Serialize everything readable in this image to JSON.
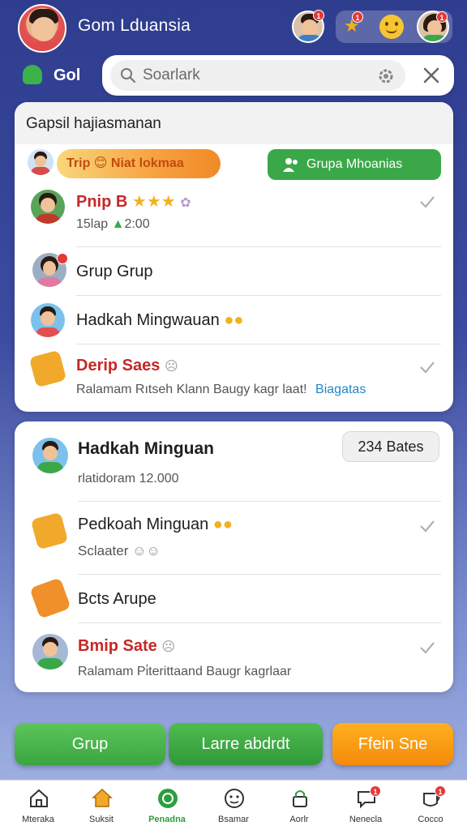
{
  "header": {
    "title": "Gom Lduansia",
    "top_badges": [
      "1",
      "1",
      "1"
    ]
  },
  "search": {
    "group_label": "Gol",
    "placeholder": "Soarlark"
  },
  "card1": {
    "title": "Gapsil hajiasmanan",
    "pill_label": "Trip 😊 Niat lokmaa",
    "button_label": "Grupa Mhoanias",
    "rows": [
      {
        "name": "Pnip B",
        "sub_left": "15lap",
        "sub_right": "2:00"
      },
      {
        "name": "Grup Grup"
      },
      {
        "name": "Hadkah Mingwauan"
      },
      {
        "name": "Derip Saes",
        "sub": "Ralamam Rıtseh Klann Baugy kagr laat!",
        "link": "Biagatas"
      }
    ]
  },
  "card2": {
    "rows": [
      {
        "name": "Hadkah Minguan",
        "sub": "rlatidoram 12.000",
        "badge": "234 Bates"
      },
      {
        "name": "Pedkoah Minguan",
        "sub": "Sclaater"
      },
      {
        "name": "Bcts Arupe"
      },
      {
        "name": "Bmip Sate",
        "sub": "Ralamam Pi̇terittaand Baugr kagrlaar"
      }
    ]
  },
  "actions": {
    "left": "Grup",
    "middle": "Larre abdrdt",
    "right": "Ffein Sne"
  },
  "nav": [
    {
      "label": "Mteraka",
      "icon": "home-icon",
      "active": false
    },
    {
      "label": "Suksit",
      "icon": "house-gold-icon",
      "active": false
    },
    {
      "label": "Penadna",
      "icon": "green-circle-icon",
      "active": true
    },
    {
      "label": "Bsamar",
      "icon": "emoji-face-icon",
      "active": false
    },
    {
      "label": "Aorlr",
      "icon": "lock-icon",
      "active": false
    },
    {
      "label": "Nenecla",
      "icon": "chat-icon",
      "active": false,
      "badge": "1"
    },
    {
      "label": "Cocco",
      "icon": "cup-icon",
      "active": false,
      "badge": "1"
    }
  ],
  "colors": {
    "accent_green": "#3aa848",
    "accent_orange": "#f58a0a",
    "name_red": "#c62828",
    "link_blue": "#1e88c8",
    "header_bg": "#2f3d8f"
  }
}
